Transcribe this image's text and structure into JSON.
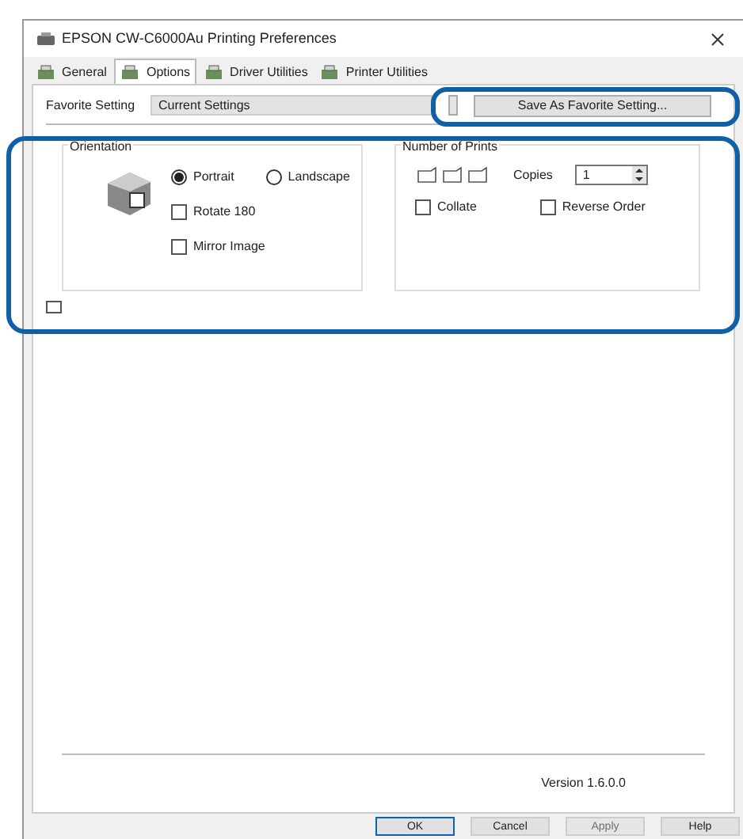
{
  "window": {
    "title": "EPSON CW-C6000Au Printing Preferences"
  },
  "tabs": [
    {
      "label": "General",
      "selected": false
    },
    {
      "label": "Options",
      "selected": true
    },
    {
      "label": "Driver Utilities",
      "selected": false
    },
    {
      "label": "Printer Utilities",
      "selected": false
    }
  ],
  "favorite_setting": {
    "label": "Favorite Setting",
    "value": "Current Settings",
    "button": "Save As Favorite Setting..."
  },
  "orientation": {
    "title": "Orientation",
    "options": [
      {
        "label": "Portrait",
        "selected": true
      },
      {
        "label": "Landscape",
        "selected": false
      }
    ],
    "checkboxes": [
      {
        "label": "Rotate 180",
        "checked": false
      },
      {
        "label": "Mirror Image",
        "checked": false
      }
    ]
  },
  "number_of_prints": {
    "title": "Number of Prints",
    "copies_label": "Copies",
    "copies_value": "1",
    "checkboxes": [
      {
        "label": "Collate",
        "checked": false
      },
      {
        "label": "Reverse Order",
        "checked": false
      }
    ]
  },
  "banner_checkbox": {
    "checked": false
  },
  "version": "Version 1.6.0.0",
  "buttons": [
    {
      "label": "OK",
      "default": true,
      "disabled": false
    },
    {
      "label": "Cancel",
      "default": false,
      "disabled": false
    },
    {
      "label": "Apply",
      "default": false,
      "disabled": true
    },
    {
      "label": "Help",
      "default": false,
      "disabled": false
    }
  ]
}
